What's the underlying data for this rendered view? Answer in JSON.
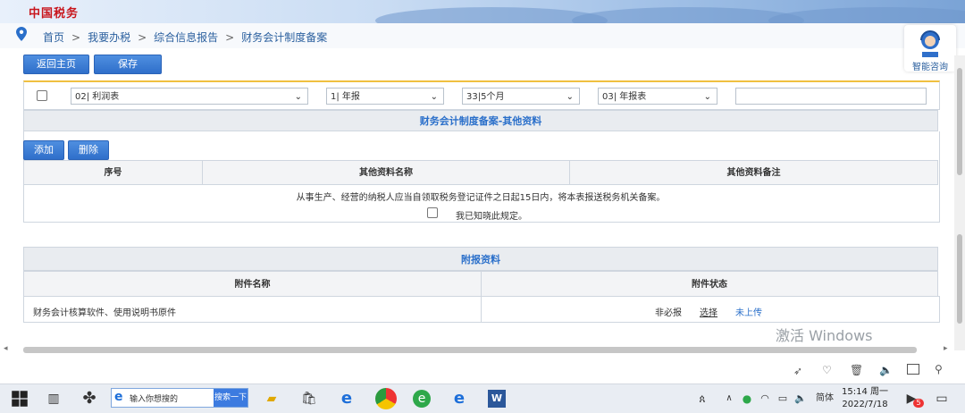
{
  "header": {
    "logo_text": "中国税务",
    "breadcrumbs": [
      "首页",
      "我要办税",
      "综合信息报告",
      "财务会计制度备案"
    ],
    "separator": ">"
  },
  "toolbar": {
    "back_label": "返回主页",
    "save_label": "保存"
  },
  "assistant": {
    "label": "智能咨询"
  },
  "report_row": {
    "report_select": "02| 利润表",
    "period_select": "1| 年报",
    "months_select": "33|5个月",
    "type_select": "03| 年报表",
    "text_value": ""
  },
  "other_section": {
    "title": "财务会计制度备案-其他资料",
    "add_label": "添加",
    "delete_label": "删除",
    "columns": [
      "序号",
      "其他资料名称",
      "其他资料备注"
    ],
    "notice": "从事生产、经营的纳税人应当自领取税务登记证件之日起15日内，将本表报送税务机关备案。",
    "ack_label": "我已知晓此规定。"
  },
  "attachment_section": {
    "title": "附报资料",
    "columns": [
      "附件名称",
      "附件状态"
    ],
    "rows": [
      {
        "name": "财务会计核算软件、使用说明书原件",
        "required": "非必报",
        "choose": "选择",
        "status": "未上传"
      }
    ]
  },
  "watermark": {
    "line1": "激活 Windows"
  },
  "taskbar": {
    "search_placeholder": "输入你想搜的",
    "search_button": "搜索一下",
    "ime": "简体",
    "time": "15:14 周一",
    "date": "2022/7/18",
    "notification_count": "5"
  },
  "colors": {
    "accent": "#2f6fca",
    "link": "#2a6fca",
    "banner": "#9fbfe6"
  }
}
